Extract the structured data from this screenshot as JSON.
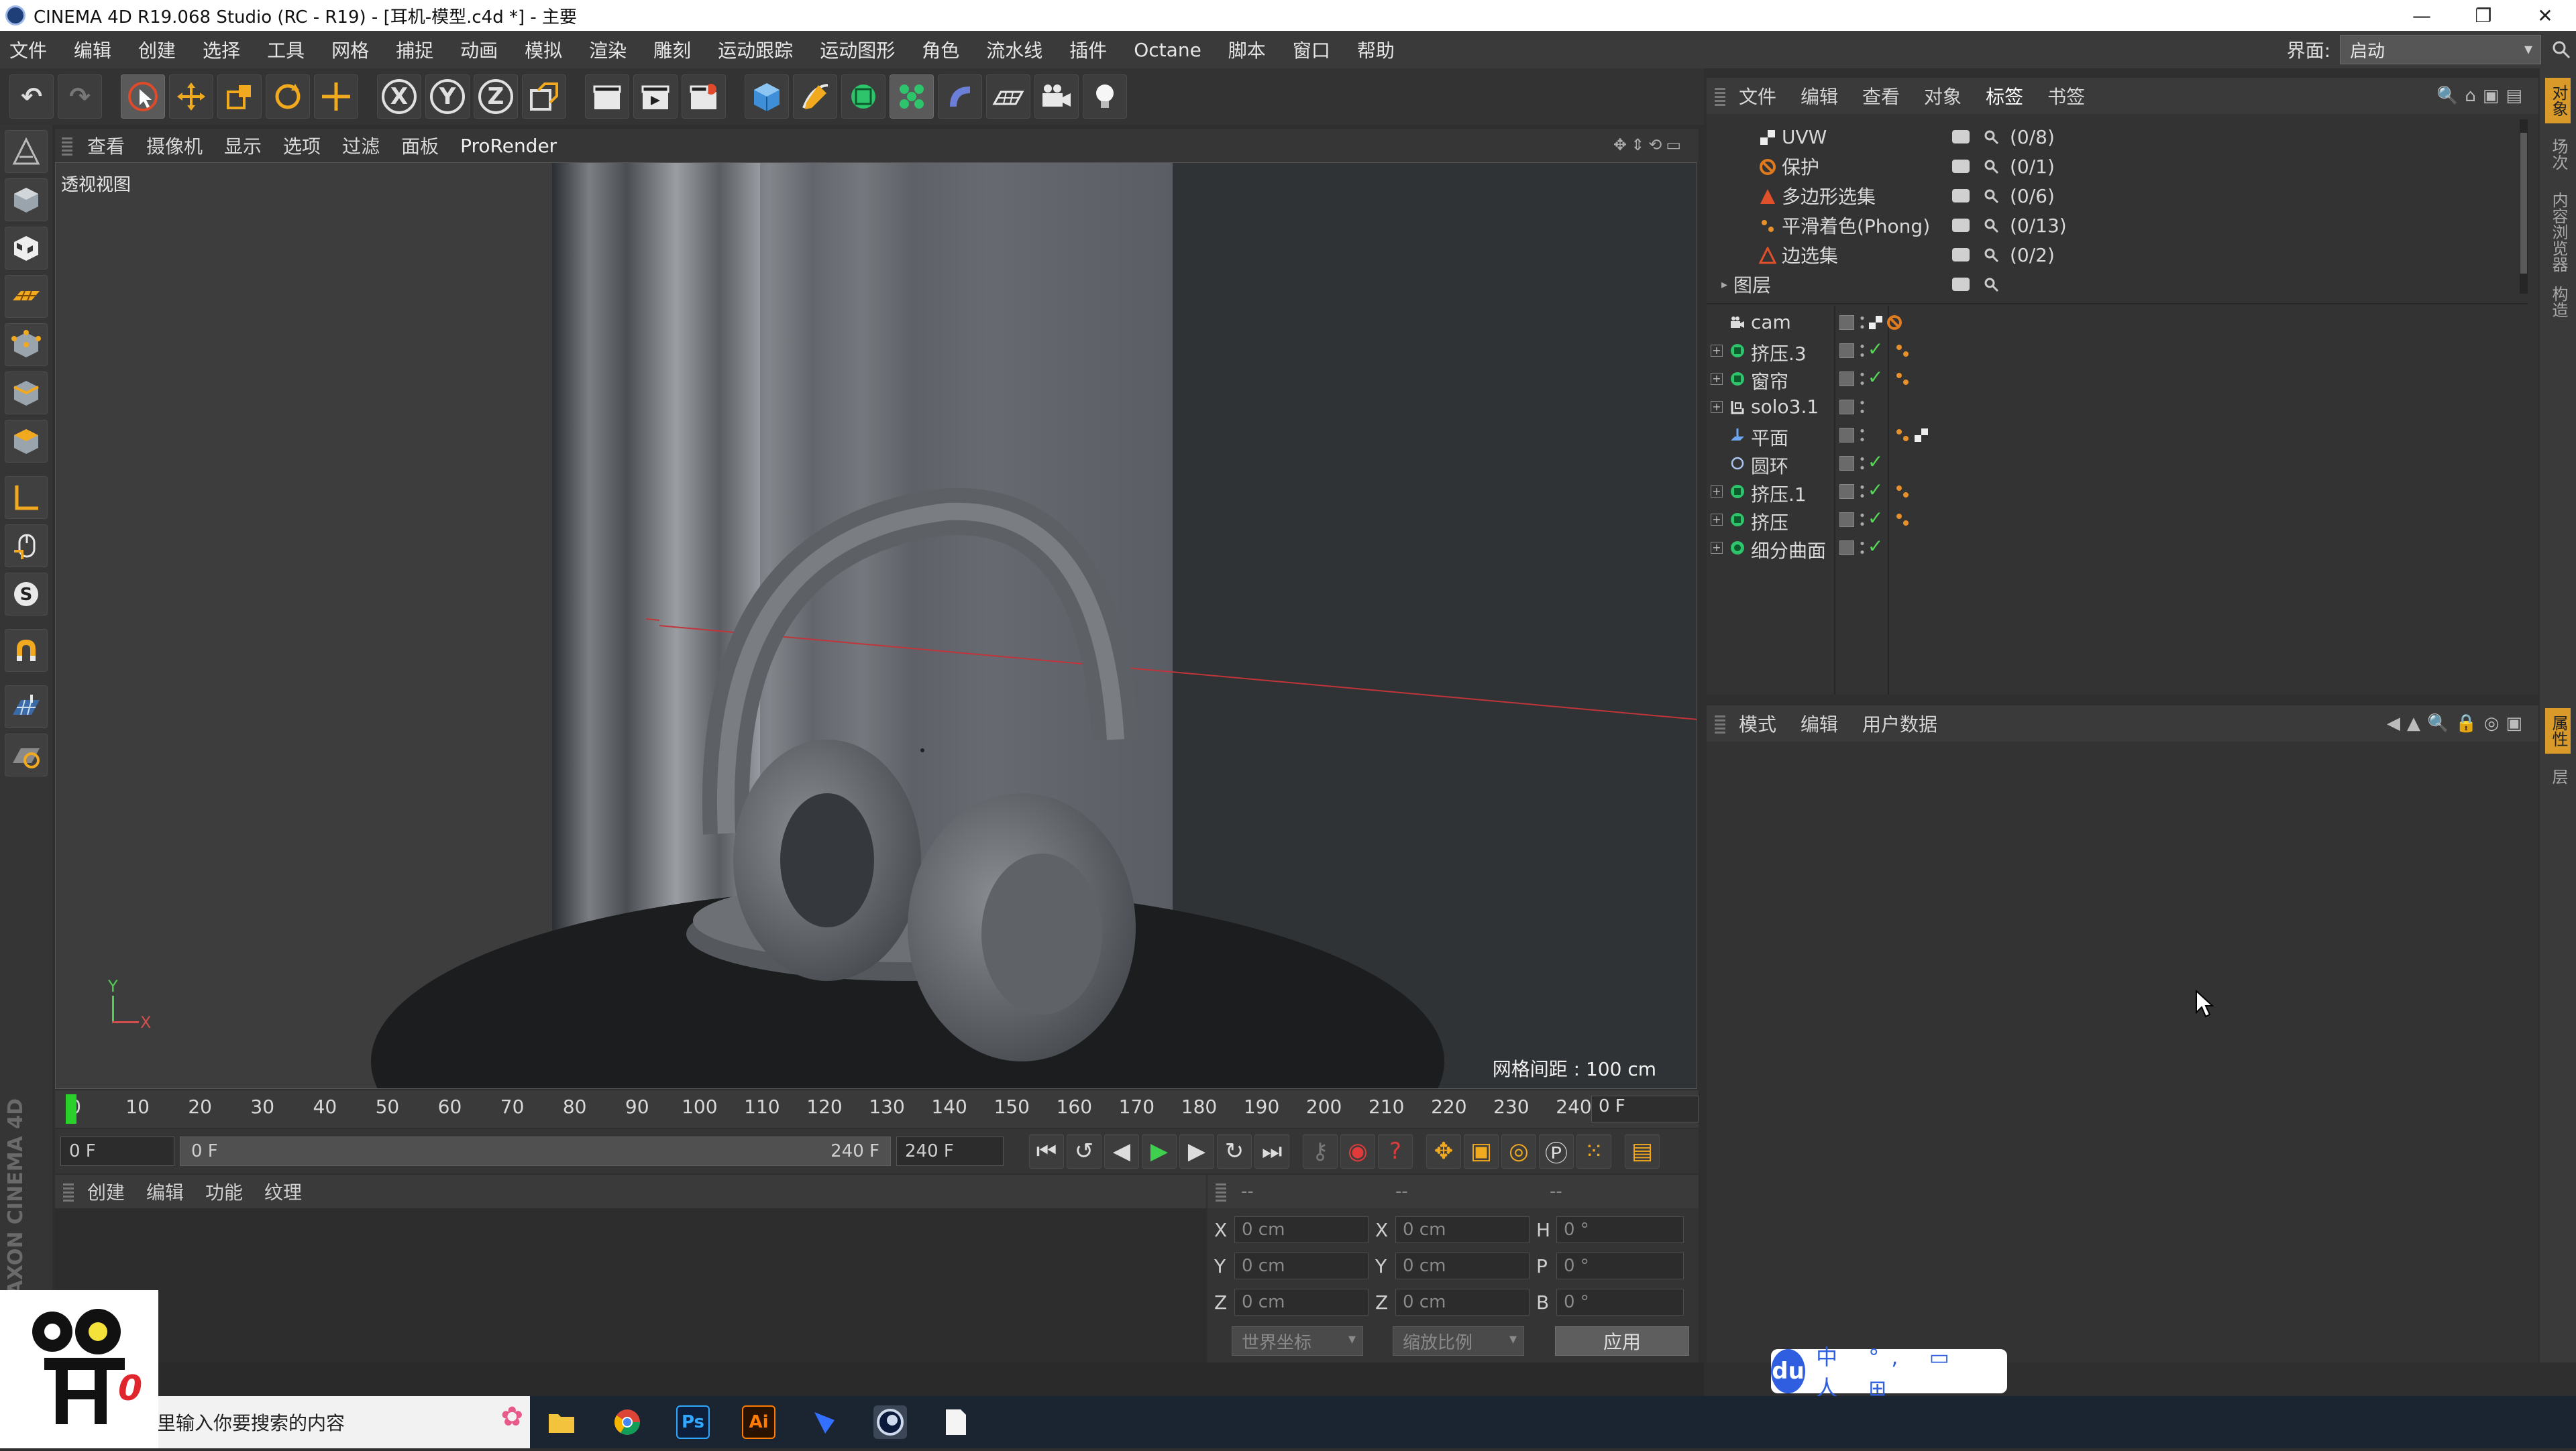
{
  "titlebar": {
    "title": "CINEMA 4D R19.068 Studio (RC - R19) - [耳机-模型.c4d *] - 主要",
    "minimize": "—",
    "restore": "❐",
    "close": "✕"
  },
  "menubar": {
    "items": [
      "文件",
      "编辑",
      "创建",
      "选择",
      "工具",
      "网格",
      "捕捉",
      "动画",
      "模拟",
      "渲染",
      "雕刻",
      "运动跟踪",
      "运动图形",
      "角色",
      "流水线",
      "插件",
      "Octane",
      "脚本",
      "窗口",
      "帮助"
    ],
    "interface_label": "界面:",
    "interface_value": "启动"
  },
  "toolbar": {
    "axis_x": "X",
    "axis_y": "Y",
    "axis_z": "Z"
  },
  "viewport": {
    "menu": [
      "查看",
      "摄像机",
      "显示",
      "选项",
      "过滤",
      "面板",
      "ProRender"
    ],
    "label": "透视视图",
    "grid_info": "网格间距 : 100 cm",
    "axis_y": "Y",
    "axis_x": "X"
  },
  "timeline": {
    "ticks": [
      "0",
      "10",
      "20",
      "30",
      "40",
      "50",
      "60",
      "70",
      "80",
      "90",
      "100",
      "110",
      "120",
      "130",
      "140",
      "150",
      "160",
      "170",
      "180",
      "190",
      "200",
      "210",
      "220",
      "230",
      "240"
    ],
    "current_frame": "0 F"
  },
  "transport": {
    "start_field": "0 F",
    "range_start": "0 F",
    "range_end": "240 F",
    "end_field": "240 F"
  },
  "material_manager": {
    "menu": [
      "创建",
      "编辑",
      "功能",
      "纹理"
    ]
  },
  "coordinates": {
    "header": [
      "--",
      "--",
      "--"
    ],
    "rows": [
      {
        "pos_label": "X",
        "pos": "0 cm",
        "size_label": "X",
        "size": "0 cm",
        "rot_label": "H",
        "rot": "0 °"
      },
      {
        "pos_label": "Y",
        "pos": "0 cm",
        "size_label": "Y",
        "size": "0 cm",
        "rot_label": "P",
        "rot": "0 °"
      },
      {
        "pos_label": "Z",
        "pos": "0 cm",
        "size_label": "Z",
        "size": "0 cm",
        "rot_label": "B",
        "rot": "0 °"
      }
    ],
    "world_dropdown": "世界坐标",
    "scale_dropdown": "缩放比例",
    "apply": "应用"
  },
  "object_manager": {
    "menu": [
      "文件",
      "编辑",
      "查看",
      "对象",
      "标签",
      "书签"
    ],
    "tag_rows": [
      {
        "name": "UVW",
        "count": "(0/8)",
        "icon": "uvw-tag-icon",
        "color": "#d8d8d8"
      },
      {
        "name": "保护",
        "count": "(0/1)",
        "icon": "protection-tag-icon",
        "color": "#e07a1f"
      },
      {
        "name": "多边形选集",
        "count": "(0/6)",
        "icon": "polygon-selection-icon",
        "color": "#e0502a"
      },
      {
        "name": "平滑着色(Phong)",
        "count": "(0/13)",
        "icon": "phong-tag-icon",
        "color": "#e8902a"
      },
      {
        "name": "边选集",
        "count": "(0/2)",
        "icon": "edge-selection-icon",
        "color": "#e0502a"
      }
    ],
    "layer_row": "图层",
    "objects": [
      {
        "name": "cam",
        "icon": "camera-icon",
        "expand": false,
        "check": false
      },
      {
        "name": "挤压.3",
        "icon": "extrude-icon",
        "expand": true,
        "check": true
      },
      {
        "name": "窗帘",
        "icon": "extrude-icon",
        "expand": true,
        "check": true
      },
      {
        "name": "solo3.1",
        "icon": "null-icon",
        "expand": true,
        "check": false
      },
      {
        "name": "平面",
        "icon": "plane-icon",
        "expand": false,
        "check": false
      },
      {
        "name": "圆环",
        "icon": "circle-spline-icon",
        "expand": false,
        "check": true
      },
      {
        "name": "挤压.1",
        "icon": "extrude-icon",
        "expand": true,
        "check": true
      },
      {
        "name": "挤压",
        "icon": "extrude-icon",
        "expand": true,
        "check": true
      },
      {
        "name": "细分曲面",
        "icon": "subdivision-icon",
        "expand": true,
        "check": true
      }
    ]
  },
  "attribute_manager": {
    "menu": [
      "模式",
      "编辑",
      "用户数据"
    ]
  },
  "side_tabs": [
    "对象",
    "场次",
    "内容浏览器",
    "构造",
    "属性",
    "层"
  ],
  "taskbar": {
    "search_placeholder": "里输入你要搜索的内容",
    "apps": [
      "file-explorer-icon",
      "chrome-icon",
      "photoshop-icon",
      "illustrator-icon",
      "feishu-icon",
      "cinema4d-icon",
      "notepad-icon"
    ],
    "ps_label": "Ps",
    "ai_label": "Ai"
  },
  "ime": {
    "logo": "du",
    "status": "中 °, ▭ 人 ⊞"
  },
  "brand": "MAXON CINEMA 4D"
}
